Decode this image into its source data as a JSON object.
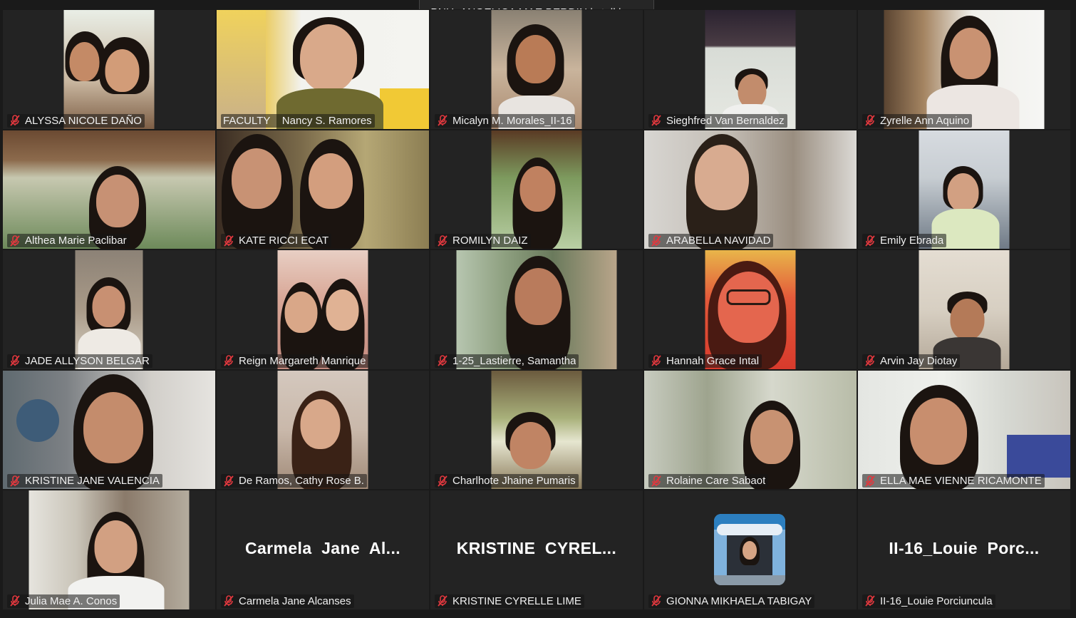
{
  "speaker_banner": "PNU_ANGELICA MAE BERDIN is talking...",
  "participants": [
    {
      "name": "ALYSSA NICOLE DAÑO",
      "muted": true
    },
    {
      "name": "FACULTY    Nancy S. Ramores",
      "muted": false
    },
    {
      "name": "Micalyn M. Morales_II-16",
      "muted": true
    },
    {
      "name": "Sieghfred Van Bernaldez",
      "muted": true
    },
    {
      "name": "Zyrelle Ann Aquino",
      "muted": true
    },
    {
      "name": "Althea Marie Paclibar",
      "muted": true
    },
    {
      "name": "KATE RICCI ECAT",
      "muted": true
    },
    {
      "name": "ROMILYN DAIZ",
      "muted": true
    },
    {
      "name": "ARABELLA NAVIDAD",
      "muted": true
    },
    {
      "name": "Emily Ebrada",
      "muted": true
    },
    {
      "name": "JADE ALLYSON BELGAR",
      "muted": true
    },
    {
      "name": "Reign Margareth Manrique",
      "muted": true
    },
    {
      "name": "1-25_Lastierre, Samantha",
      "muted": true
    },
    {
      "name": "Hannah Grace Intal",
      "muted": true
    },
    {
      "name": "Arvin Jay Diotay",
      "muted": true
    },
    {
      "name": "KRISTINE JANE VALENCIA",
      "muted": true
    },
    {
      "name": "De Ramos, Cathy Rose B.",
      "muted": true
    },
    {
      "name": "Charlhote Jhaine Pumaris",
      "muted": true
    },
    {
      "name": "Rolaine Care Sabaot",
      "muted": true
    },
    {
      "name": "ELLA MAE VIENNE RICAMONTE",
      "muted": true
    },
    {
      "name": "Julia Mae A. Conos",
      "muted": true
    },
    {
      "name": "Carmela Jane Alcanses",
      "muted": true,
      "display_name": "Carmela  Jane  Al..."
    },
    {
      "name": "KRISTINE CYRELLE LIME",
      "muted": true,
      "display_name": "KRISTINE  CYREL..."
    },
    {
      "name": "GIONNA MIKHAELA TABIGAY",
      "muted": true
    },
    {
      "name": "II-16_Louie Porciuncula",
      "muted": true,
      "display_name": "II-16_Louie  Porc..."
    }
  ],
  "colors": {
    "background": "#1a1a1a",
    "muted_icon": "#e0383e"
  }
}
